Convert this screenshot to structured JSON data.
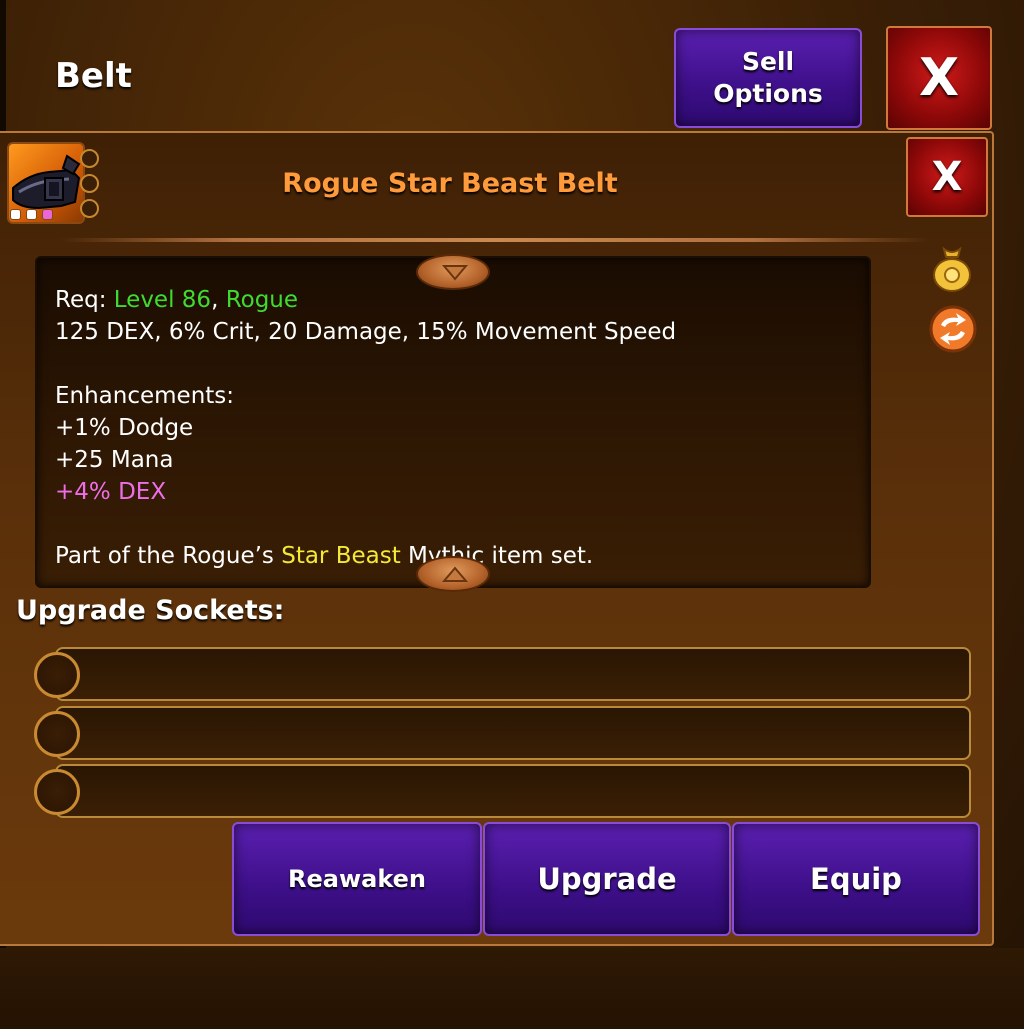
{
  "header": {
    "title": "Belt",
    "sell_label": "Sell\nOptions",
    "close_label": "X"
  },
  "item": {
    "name": "Rogue Star Beast Belt",
    "close_label": "X",
    "icon": "belt-item-icon",
    "gem_slots": 3,
    "rarity_dots": [
      "#ffffff",
      "#ffffff",
      "#ee66d6"
    ]
  },
  "description": {
    "req_prefix": "Req: ",
    "req_level": "Level 86",
    "req_sep": ", ",
    "req_class": "Rogue",
    "stats": "125 DEX, 6% Crit, 20 Damage, 15% Movement Speed",
    "enhancements_label": "Enhancements:",
    "enhancements": [
      {
        "text": "+1% Dodge",
        "color": "#ffffff"
      },
      {
        "text": "+25 Mana",
        "color": "#ffffff"
      },
      {
        "text": "+4% DEX",
        "color": "#ee6ee8"
      }
    ],
    "set_prefix": "Part of the Rogue’s ",
    "set_name": "Star Beast",
    "set_suffix": " Mythic item set."
  },
  "side_icons": [
    "gold-bag-icon",
    "swap-icon"
  ],
  "sockets": {
    "label": "Upgrade Sockets:",
    "count": 3
  },
  "actions": {
    "reawaken": "Reawaken",
    "upgrade": "Upgrade",
    "equip": "Equip"
  },
  "colors": {
    "title_orange": "#ff9b3a",
    "button_purple": "#3d0f88",
    "close_red": "#b50d0d",
    "req_green": "#3fdc2f",
    "set_yellow": "#f4ea36",
    "dex_pink": "#ee6ee8"
  }
}
